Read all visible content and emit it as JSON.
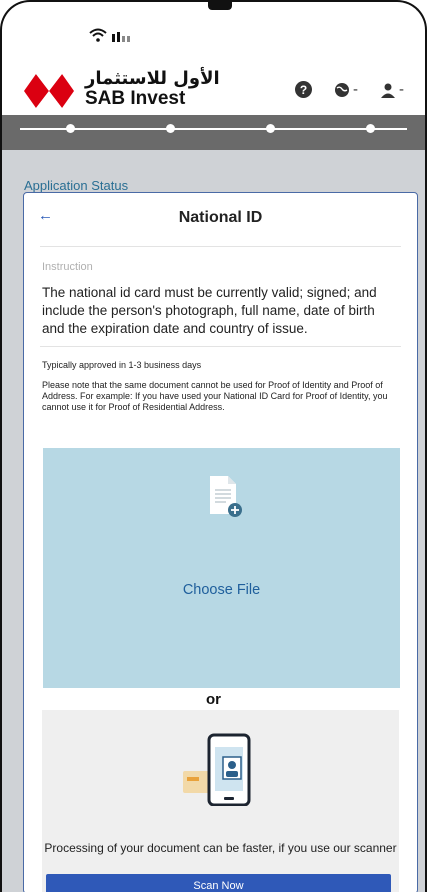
{
  "header": {
    "logo_arabic": "الأول للاستثمار",
    "logo_english": "SAB Invest",
    "help_icon": "question-circle-icon",
    "globe_icon": "globe-icon",
    "user_icon": "user-icon",
    "dropdown_glyph": "-"
  },
  "progress": {
    "steps": 4
  },
  "page": {
    "section_label": "Application Status"
  },
  "card": {
    "title": "National ID",
    "back_icon": "←",
    "instruction_label": "Instruction",
    "instruction_text": "The national id card must be currently valid; signed; and include the person's photograph, full name, date of birth and the expiration date and country of issue.",
    "approval_time": "Typically approved in 1-3 business days",
    "note": "Please note that the same document cannot be used for Proof of Identity and Proof of Address. For example: If you have used your National ID Card for Proof of Identity, you cannot use it for Proof of Residential Address.",
    "upload": {
      "label": "Choose File",
      "icon": "add-document-icon"
    },
    "or_label": "or",
    "scan": {
      "text": "Processing of your document can be faster, if you use our scanner",
      "button": "Scan Now",
      "icon": "phone-scan-icon"
    }
  },
  "colors": {
    "progress_bar": "#6a6a6a",
    "page_bg": "#cfd2d6",
    "drop_zone": "#b7d8e4",
    "link": "#1f5f9c",
    "button": "#2f59b8",
    "brand_red": "#db0011"
  }
}
